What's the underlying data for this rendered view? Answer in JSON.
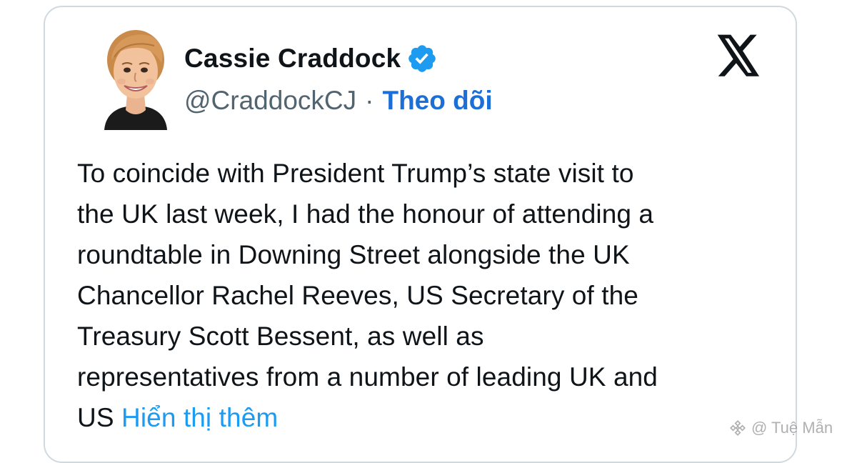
{
  "tweet": {
    "author": {
      "name": "Cassie Craddock",
      "handle": "@CraddockCJ",
      "verified": true,
      "separator": "·",
      "follow_label": "Theo dõi"
    },
    "body_lines": [
      "To coincide with President Trump’s state visit to",
      "the UK last week, I had the honour of attending a",
      "roundtable in Downing Street alongside the UK",
      "Chancellor Rachel Reeves, US Secretary of the",
      "Treasury Scott Bessent, as well as",
      "representatives from a number of leading UK and",
      "US"
    ],
    "show_more_label": "Hiển thị thêm"
  },
  "watermark": {
    "text": "@ Tuệ Mẫn"
  },
  "colors": {
    "text": "#0f1419",
    "secondary": "#536471",
    "follow": "#1d6fd8",
    "link": "#1d9bf0",
    "verified": "#1d9bf0",
    "border": "#cfd9de"
  },
  "icons": {
    "logo": "x-logo-icon",
    "verified": "verified-badge-icon",
    "watermark": "binance-diamond-icon"
  }
}
